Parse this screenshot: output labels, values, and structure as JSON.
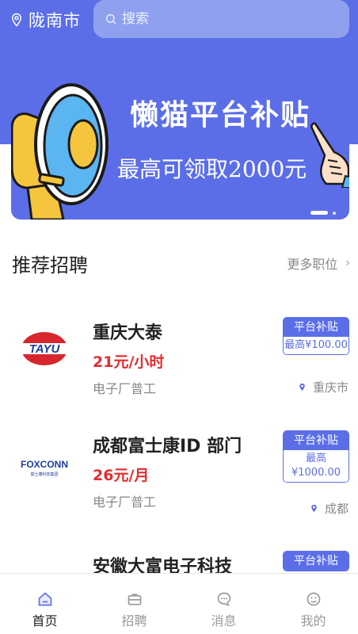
{
  "header": {
    "location": "陇南市",
    "search_placeholder": "搜索"
  },
  "banner": {
    "title": "懒猫平台补贴",
    "subtitle": "最高可领取2000元",
    "page_count": 2,
    "active_page": 1
  },
  "section": {
    "title": "推荐招聘",
    "more": "更多职位"
  },
  "jobs": [
    {
      "logo_text": "TAYU",
      "name": "重庆大泰",
      "pay": "21元/小时",
      "category": "电子厂普工",
      "badge_title": "平台补贴",
      "badge_value": "最高¥100.00",
      "city": "重庆市"
    },
    {
      "logo_text": "FOXCONN",
      "logo_sub": "富士康科技集团",
      "name": "成都富士康ID 部门",
      "pay": "26元/月",
      "category": "电子厂普工",
      "badge_title": "平台补贴",
      "badge_value_line1": "最高",
      "badge_value_line2": "¥1000.00",
      "city": "成都"
    },
    {
      "name": "安徽大富电子科技",
      "badge_title": "平台补贴"
    }
  ],
  "nav": {
    "items": [
      {
        "label": "首页",
        "icon": "home-icon",
        "active": true
      },
      {
        "label": "招聘",
        "icon": "briefcase-icon",
        "active": false
      },
      {
        "label": "消息",
        "icon": "message-icon",
        "active": false
      },
      {
        "label": "我的",
        "icon": "profile-icon",
        "active": false
      }
    ]
  },
  "colors": {
    "primary": "#5b6ee8",
    "pay_red": "#e32d2d",
    "tayu_red": "#d7262d",
    "tayu_blue": "#1d3f9a"
  }
}
